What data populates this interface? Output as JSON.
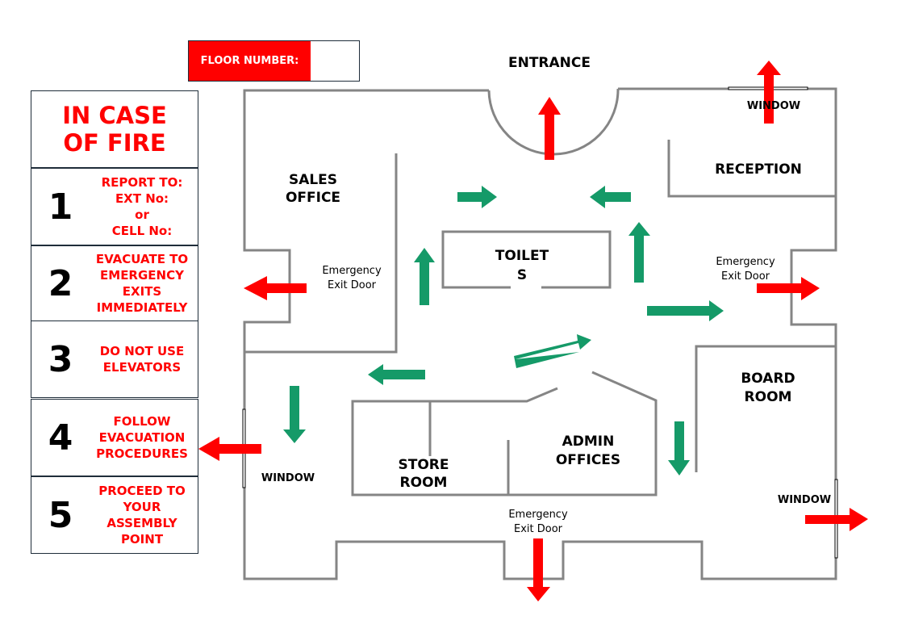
{
  "floor_number": {
    "label": "FLOOR NUMBER:",
    "value": ""
  },
  "instructions": {
    "title": "IN CASE\nOF FIRE",
    "steps": [
      {
        "number": "1",
        "text": "REPORT TO:\nEXT No:\nor\nCELL No:"
      },
      {
        "number": "2",
        "text": "EVACUATE TO\nEMERGENCY\nEXITS\nIMMEDIATELY"
      },
      {
        "number": "3",
        "text": "DO NOT USE\nELEVATORS"
      },
      {
        "number": "4",
        "text": "FOLLOW\nEVACUATION\nPROCEDURES"
      },
      {
        "number": "5",
        "text": "PROCEED TO\nYOUR\nASSEMBLY\nPOINT"
      }
    ]
  },
  "floor_plan": {
    "entrance_label": "ENTRANCE",
    "rooms": {
      "sales_office": [
        "SALES",
        "OFFICE"
      ],
      "reception": [
        "RECEPTION"
      ],
      "toilets": [
        "TOILET",
        "S"
      ],
      "board_room": [
        "BOARD",
        "ROOM"
      ],
      "store_room": [
        "STORE",
        "ROOM"
      ],
      "admin_offices": [
        "ADMIN",
        "OFFICES"
      ]
    },
    "exit_door_label": [
      "Emergency",
      "Exit Door"
    ],
    "window_label": "WINDOW"
  },
  "colors": {
    "exit_arrow": "#ff0000",
    "route_arrow": "#159a68",
    "wall": "#858585",
    "accent_red": "#ff0000"
  }
}
